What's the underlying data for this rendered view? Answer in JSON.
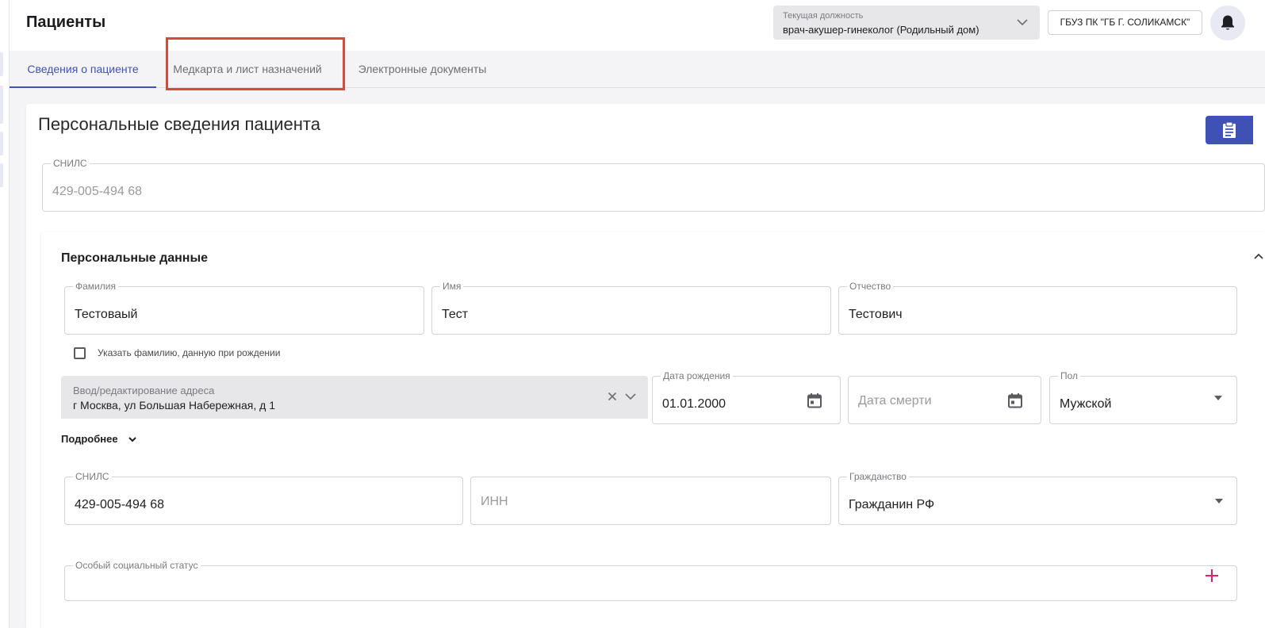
{
  "header": {
    "title": "Пациенты",
    "position_label": "Текущая должность",
    "position_value": "врач-акушер-гинеколог (Родильный дом)",
    "org_label": "ГБУЗ ПК \"ГБ Г. СОЛИКАМСК\""
  },
  "tabs": [
    {
      "label": "Сведения о пациенте",
      "active": true
    },
    {
      "label": "Медкарта и лист назначений",
      "active": false
    },
    {
      "label": "Электронные документы",
      "active": false
    }
  ],
  "main": {
    "section_title": "Персональные сведения пациента",
    "snils_top": {
      "label": "СНИЛС",
      "value": "429-005-494 68"
    }
  },
  "personal": {
    "title": "Персональные данные",
    "surname": {
      "label": "Фамилия",
      "value": "Тестоваый"
    },
    "name": {
      "label": "Имя",
      "value": "Тест"
    },
    "patronymic": {
      "label": "Отчество",
      "value": "Тестович"
    },
    "birth_surname_checkbox": "Указать фамилию, данную при рождении",
    "address": {
      "label": "Ввод/редактирование адреса",
      "value": "г Москва, ул Большая Набережная, д 1"
    },
    "birth_date": {
      "label": "Дата рождения",
      "value": "01.01.2000"
    },
    "death_date": {
      "placeholder": "Дата смерти"
    },
    "gender": {
      "label": "Пол",
      "value": "Мужской"
    },
    "more_label": "Подробнее",
    "snils": {
      "label": "СНИЛС",
      "value": "429-005-494 68"
    },
    "inn": {
      "placeholder": "ИНН"
    },
    "citizenship": {
      "label": "Гражданство",
      "value": "Гражданин РФ"
    },
    "social_status": {
      "label": "Особый социальный статус"
    }
  },
  "colors": {
    "accent": "#3f51b5",
    "highlight": "#d44a3d",
    "add": "#e91e63"
  }
}
